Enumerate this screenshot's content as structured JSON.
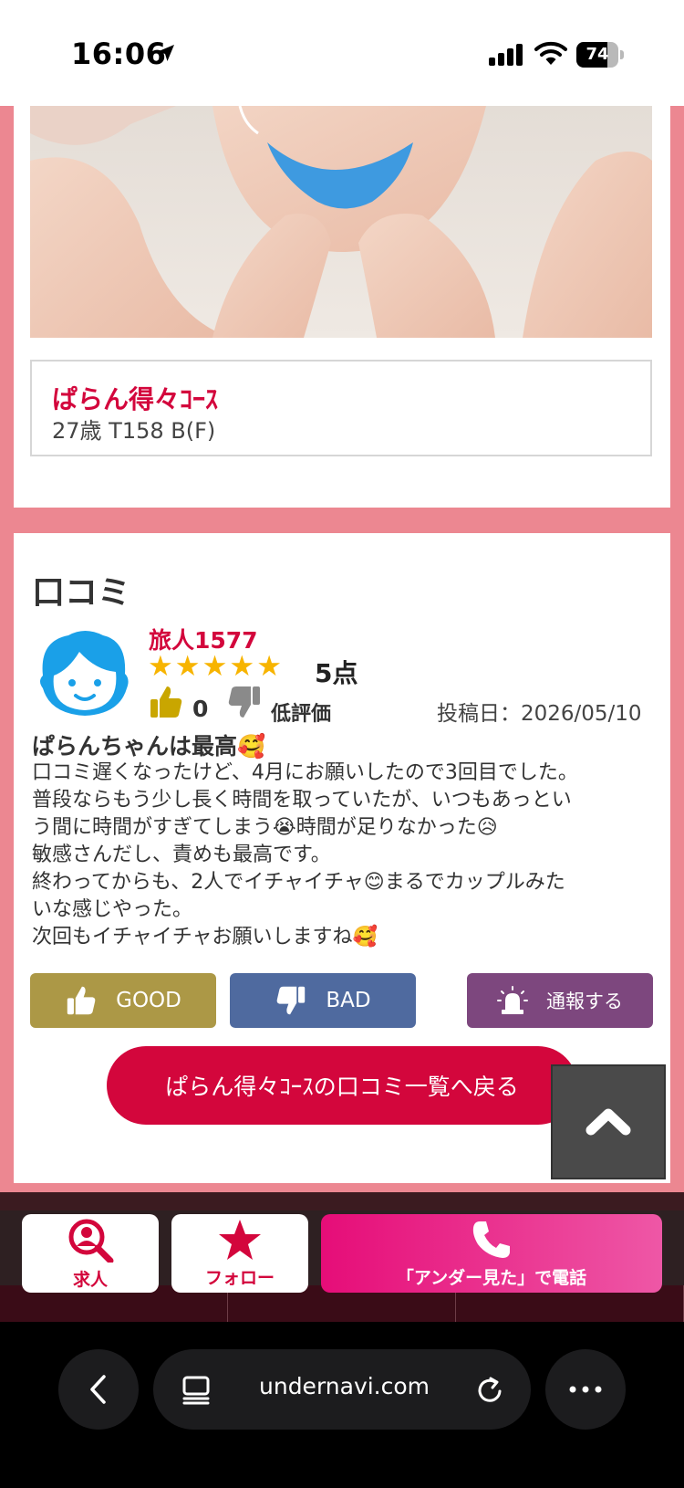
{
  "status_bar": {
    "time": "16:06",
    "battery": "74",
    "battery_level": 0.74
  },
  "profile": {
    "course_name": "ぱらん得々ｺｰｽ",
    "stats": "27歳 T158 B(F)"
  },
  "review": {
    "section_title": "口コミ",
    "reviewer": "旅人1577",
    "stars": 5,
    "score": "5点",
    "like_count": "0",
    "low_rating_label": "低評価",
    "post_date": "投稿日：2026/05/10",
    "title": "ぱらんちゃんは最高🥰",
    "body_lines": [
      "口コミ遅くなったけど、4月にお願いしたので3回目でした。",
      "普段ならもう少し長く時間を取っていたが、いつもあっとい",
      "う間に時間がすぎてしまう😭時間が足りなかった😥",
      "敏感さんだし、責めも最高です。",
      "終わってからも、2人でイチャイチャ😊まるでカップルみた",
      "いな感じやった。",
      "次回もイチャイチャお願いしますね🥰"
    ]
  },
  "buttons": {
    "good": "GOOD",
    "bad": "BAD",
    "report": "通報する",
    "back_to_list": "ぱらん得々ｺｰｽの口コミ一覧へ戻る"
  },
  "footer_bar": {
    "job": "求人",
    "follow": "フォロー",
    "call": "「アンダー見た」で電話"
  },
  "browser": {
    "url": "undernavi.com"
  },
  "colors": {
    "accent": "#d3063c",
    "page_bg": "#ec8791",
    "good": "#ac9846",
    "bad": "#4f6a9f",
    "report": "#7d477e",
    "call": "#e60d78",
    "star": "#f7b400"
  },
  "icons": [
    "location-arrow-icon",
    "signal-icon",
    "wifi-icon",
    "battery-icon",
    "avatar-icon",
    "star-icon",
    "thumbs-up-icon",
    "thumbs-down-icon",
    "siren-icon",
    "chevron-up-icon",
    "search-person-icon",
    "phone-icon",
    "chevron-left-icon",
    "tabs-icon",
    "reload-icon",
    "more-icon"
  ]
}
